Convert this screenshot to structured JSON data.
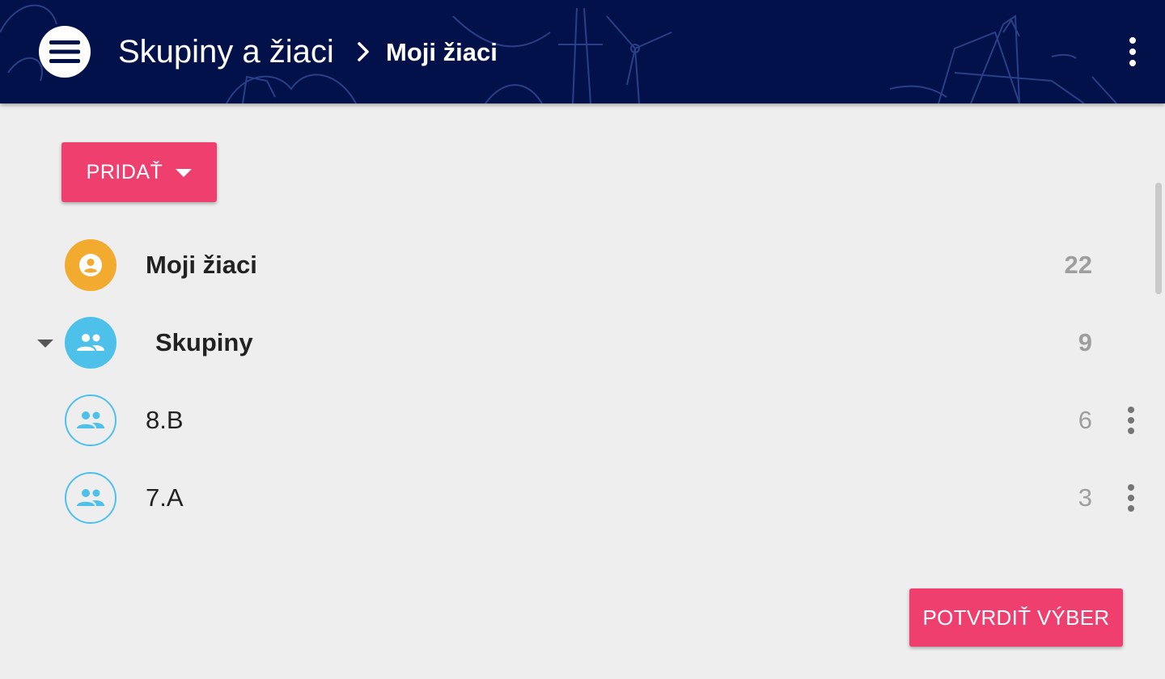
{
  "header": {
    "breadcrumb_parent": "Skupiny a žiaci",
    "breadcrumb_current": "Moji žiaci",
    "background_color": "#03114a"
  },
  "toolbar": {
    "add_label": "PRIDAŤ"
  },
  "list": {
    "items": [
      {
        "label": "Moji žiaci",
        "count": "22",
        "icon": "person-circle-icon",
        "style": "filled-orange"
      },
      {
        "label": "Skupiny",
        "count": "9",
        "icon": "group-icon",
        "style": "filled-blue",
        "expanded": true
      },
      {
        "label": "8.B",
        "count": "6",
        "icon": "group-icon",
        "style": "outline-blue"
      },
      {
        "label": "7.A",
        "count": "3",
        "icon": "group-icon",
        "style": "outline-blue"
      }
    ]
  },
  "footer": {
    "confirm_label": "POTVRDIŤ VÝBER"
  },
  "colors": {
    "accent": "#ef3f6e",
    "orange": "#f2ab2f",
    "blue": "#4ec1eb",
    "background": "#eeeeee"
  }
}
